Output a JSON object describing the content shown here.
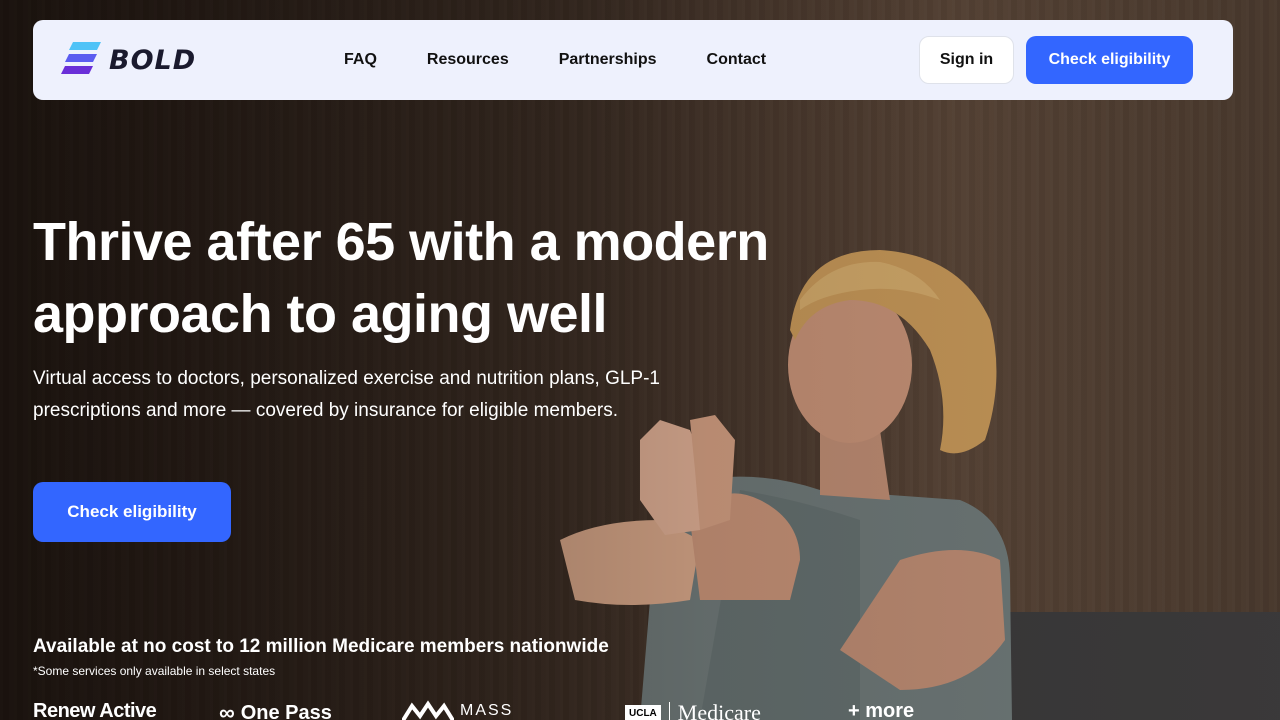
{
  "brand": {
    "name": "BOLD"
  },
  "nav": {
    "links": [
      "FAQ",
      "Resources",
      "Partnerships",
      "Contact"
    ],
    "signin_label": "Sign in",
    "cta_label": "Check eligibility"
  },
  "hero": {
    "headline": "Thrive after 65 with a modern approach to aging well",
    "subhead": "Virtual access to doctors, personalized exercise and nutrition plans, GLP-1 prescriptions and more — covered by insurance for eligible members.",
    "cta_label": "Check eligibility"
  },
  "availability": {
    "text": "Available at no cost to 12 million Medicare members nationwide",
    "footnote": "*Some services only available in select states"
  },
  "partners": {
    "renew_active": "Renew Active",
    "one_pass": "One Pass",
    "mass": "MASS",
    "ucla_badge": "UCLA",
    "ucla_medicare": "Medicare",
    "more": "+ more"
  },
  "colors": {
    "accent": "#3366ff",
    "nav_bg": "#eef1fd",
    "logo_top": "#4fc3f7",
    "logo_mid": "#5b5cf0",
    "logo_bottom": "#6a2fd8"
  }
}
